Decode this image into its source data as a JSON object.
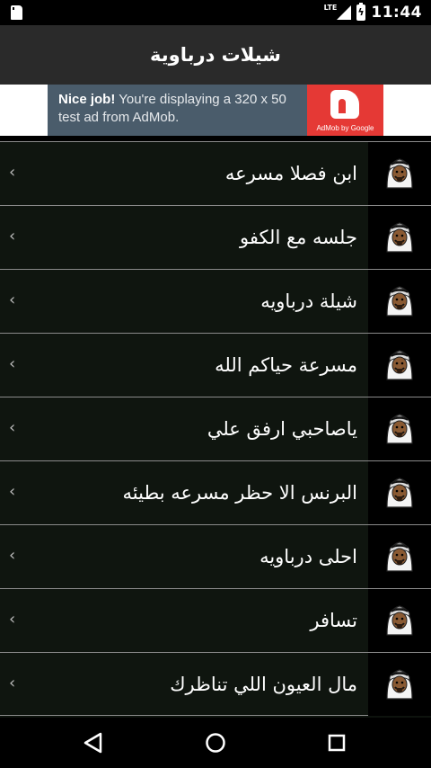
{
  "status_bar": {
    "network": "LTE",
    "time": "11:44"
  },
  "app_bar": {
    "title": "شيلات درباوية"
  },
  "ad": {
    "headline": "Nice job!",
    "body": " You're displaying a 320 x 50 test ad from AdMob.",
    "brand": "AdMob by Google"
  },
  "list": {
    "items": [
      {
        "label": "ابن فصلا مسرعه",
        "icon": "arab-man-avatar-icon"
      },
      {
        "label": "جلسه مع الكفو",
        "icon": "arab-man-avatar-icon"
      },
      {
        "label": "شيلة درباويه",
        "icon": "arab-man-avatar-icon"
      },
      {
        "label": "مسرعة حياكم الله",
        "icon": "arab-man-avatar-icon"
      },
      {
        "label": "ياصاحبي ارفق علي",
        "icon": "arab-man-avatar-icon"
      },
      {
        "label": "البرنس الا حظر مسرعه بطيئه",
        "icon": "arab-man-avatar-icon"
      },
      {
        "label": "احلى درباويه",
        "icon": "arab-man-avatar-icon"
      },
      {
        "label": "تسافر",
        "icon": "arab-man-avatar-icon"
      },
      {
        "label": "مال العيون اللي تناظرك",
        "icon": "arab-man-avatar-icon"
      }
    ],
    "chevron": "‹"
  },
  "nav_bar": {
    "back": "back-icon",
    "home": "home-icon",
    "recents": "recents-icon"
  }
}
